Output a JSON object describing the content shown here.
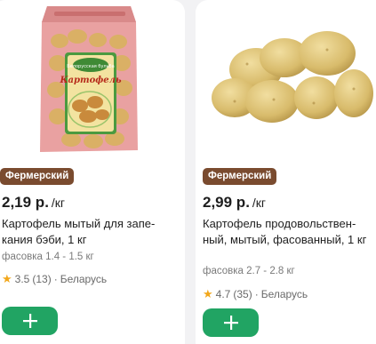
{
  "products": [
    {
      "badge": "Фермерский",
      "price": "2,19 р.",
      "unit": "/кг",
      "title": "Картофель мытый для запе-кания бэби, 1 кг",
      "pack": "фасовка 1.4 - 1.5 кг",
      "rating": "3.5",
      "reviews": "(13)",
      "separator": "·",
      "origin": "Беларусь",
      "bag_label": "Картофель",
      "bag_brand": "Белорусская бульба"
    },
    {
      "badge": "Фермерский",
      "price": "2,99 р.",
      "unit": "/кг",
      "title": "Картофель продовольствен-ный, мытый, фасованный, 1 кг",
      "pack": "фасовка 2.7 - 2.8 кг",
      "rating": "4.7",
      "reviews": "(35)",
      "separator": "·",
      "origin": "Беларусь"
    }
  ],
  "colors": {
    "badge": "#7a4b2f",
    "add_button": "#21a463",
    "star": "#f2a71b"
  },
  "icons": {
    "add": "plus-icon",
    "rating": "star-icon"
  }
}
